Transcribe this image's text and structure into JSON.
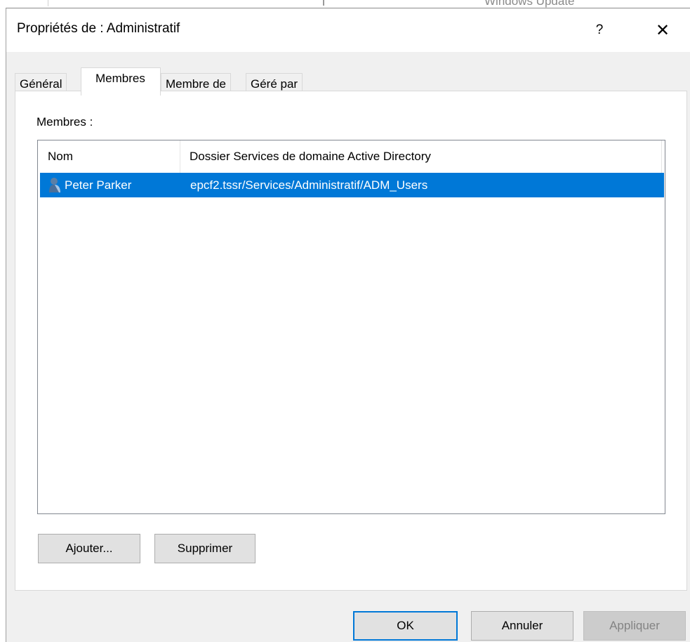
{
  "background_window": {
    "partial_title": "Windows Update"
  },
  "window": {
    "title": "Propriétés de : Administratif",
    "help_label": "?",
    "close_label": "✕"
  },
  "tabs": [
    {
      "label": "Général",
      "active": false
    },
    {
      "label": "Membres",
      "active": true
    },
    {
      "label": "Membre de",
      "active": false
    },
    {
      "label": "Géré par",
      "active": false
    }
  ],
  "members": {
    "label": "Membres :",
    "columns": [
      "Nom",
      "Dossier Services de domaine Active Directory"
    ],
    "rows": [
      {
        "icon": "user-icon",
        "name": "Peter Parker",
        "folder": "epcf2.tssr/Services/Administratif/ADM_Users",
        "selected": true
      }
    ]
  },
  "buttons": {
    "add": "Ajouter...",
    "remove": "Supprimer",
    "ok": "OK",
    "cancel": "Annuler",
    "apply": "Appliquer"
  },
  "colors": {
    "selection": "#0078d7",
    "dialog_bg": "#f0f0f0",
    "disabled_text": "#838383"
  }
}
